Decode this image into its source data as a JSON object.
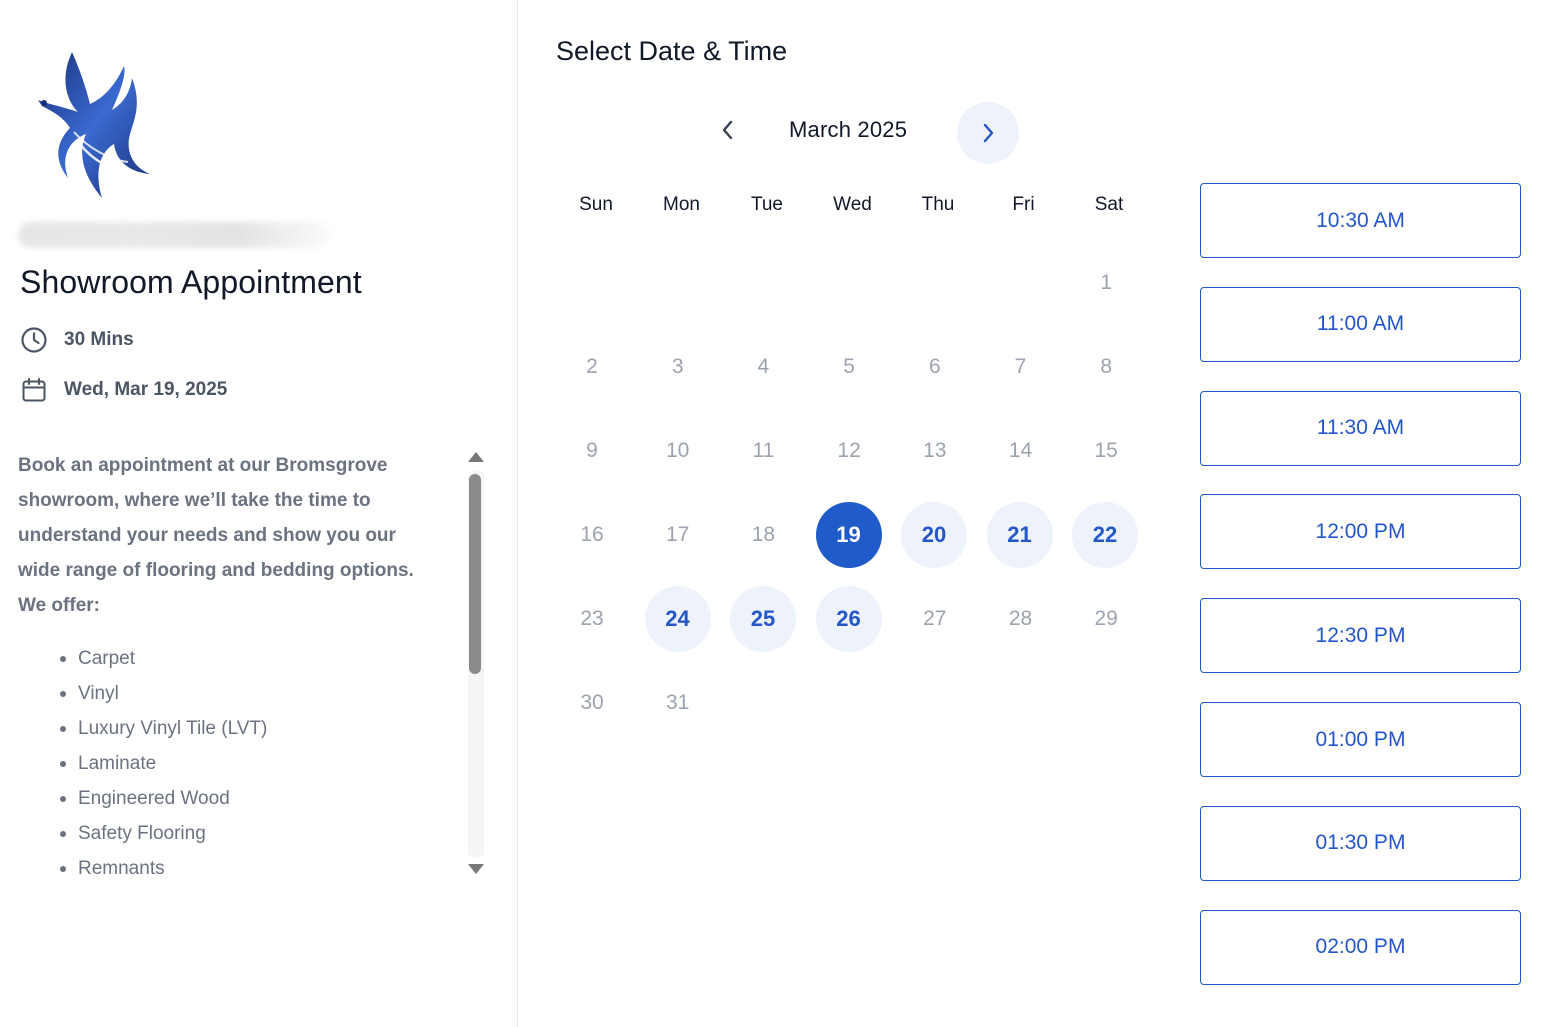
{
  "event": {
    "title": "Showroom Appointment",
    "duration": "30 Mins",
    "date": "Wed, Mar 19, 2025",
    "description": "Book an appointment at our Bromsgrove showroom, where we’ll take the time to understand your needs and show you our wide range of flooring and bedding options. We offer:",
    "offers": [
      "Carpet",
      "Vinyl",
      "Luxury Vinyl Tile (LVT)",
      "Laminate",
      "Engineered Wood",
      "Safety Flooring",
      "Remnants"
    ]
  },
  "calendar": {
    "title": "Select Date & Time",
    "month_label": "March 2025",
    "weekdays": [
      "Sun",
      "Mon",
      "Tue",
      "Wed",
      "Thu",
      "Fri",
      "Sat"
    ],
    "first_weekday_index": 6,
    "days_in_month": 31,
    "selected_day": 19,
    "available_days": [
      20,
      21,
      22,
      24,
      25,
      26
    ]
  },
  "time_slots": [
    "10:30 AM",
    "11:00 AM",
    "11:30 AM",
    "12:00 PM",
    "12:30 PM",
    "01:00 PM",
    "01:30 PM",
    "02:00 PM"
  ],
  "colors": {
    "accent": "#1f5bc9",
    "accent_light": "#eef2fa",
    "muted_day": "#9ca3af"
  },
  "icons": {
    "logo": "phoenix-logo",
    "duration": "clock-icon",
    "date": "calendar-icon",
    "prev": "chevron-left-icon",
    "next": "chevron-right-icon"
  }
}
